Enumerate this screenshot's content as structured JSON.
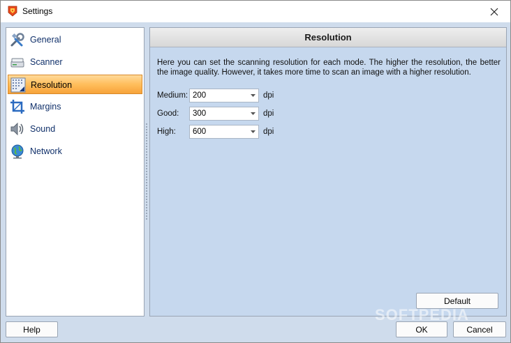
{
  "window": {
    "title": "Settings"
  },
  "sidebar": {
    "items": [
      {
        "label": "General",
        "icon": "tools-icon",
        "selected": false
      },
      {
        "label": "Scanner",
        "icon": "scanner-icon",
        "selected": false
      },
      {
        "label": "Resolution",
        "icon": "resolution-icon",
        "selected": true
      },
      {
        "label": "Margins",
        "icon": "crop-icon",
        "selected": false
      },
      {
        "label": "Sound",
        "icon": "speaker-icon",
        "selected": false
      },
      {
        "label": "Network",
        "icon": "globe-icon",
        "selected": false
      }
    ]
  },
  "panel": {
    "header": "Resolution",
    "description": "Here you can set the scanning resolution for each mode. The higher the resolution, the better the image quality. However, it takes more time to scan an image with a higher resolution.",
    "rows": [
      {
        "label": "Medium:",
        "value": "200",
        "unit": "dpi"
      },
      {
        "label": "Good:",
        "value": "300",
        "unit": "dpi"
      },
      {
        "label": "High:",
        "value": "600",
        "unit": "dpi"
      }
    ],
    "default_label": "Default"
  },
  "footer": {
    "help_label": "Help",
    "ok_label": "OK",
    "cancel_label": "Cancel"
  },
  "watermark": "SOFTPEDIA",
  "colors": {
    "selected_start": "#ffd99a",
    "selected_end": "#f7a33a",
    "panel_bg": "#c6d8ee",
    "nav_text": "#10306a"
  }
}
